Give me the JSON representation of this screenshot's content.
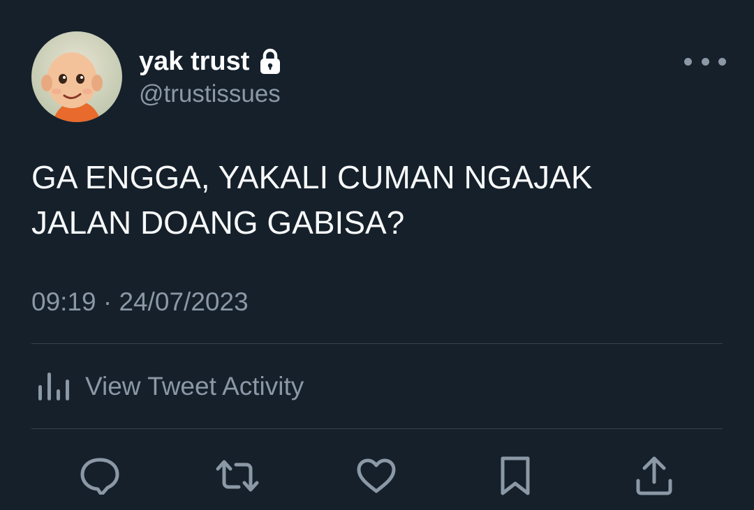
{
  "author": {
    "display_name": "yak trust",
    "handle": "@trustissues",
    "avatar_icon": "cartoon-boy-avatar",
    "protected_icon": "lock-icon"
  },
  "tweet": {
    "text": "GA ENGGA, YAKALI CUMAN NGAJAK\nJALAN DOANG GABISA?",
    "timestamp": "09:19 · 24/07/2023"
  },
  "activity": {
    "label": "View Tweet Activity",
    "icon": "bar-chart-icon"
  },
  "actions": [
    {
      "name": "reply",
      "icon": "speech-bubble-icon"
    },
    {
      "name": "retweet",
      "icon": "retweet-arrows-icon"
    },
    {
      "name": "like",
      "icon": "heart-icon"
    },
    {
      "name": "bookmark",
      "icon": "bookmark-icon"
    },
    {
      "name": "share",
      "icon": "upload-arrow-icon"
    }
  ],
  "colors": {
    "background": "#15202b",
    "primary_text": "#f7f9f9",
    "secondary_text": "#8b98a5",
    "divider": "#38444d"
  }
}
